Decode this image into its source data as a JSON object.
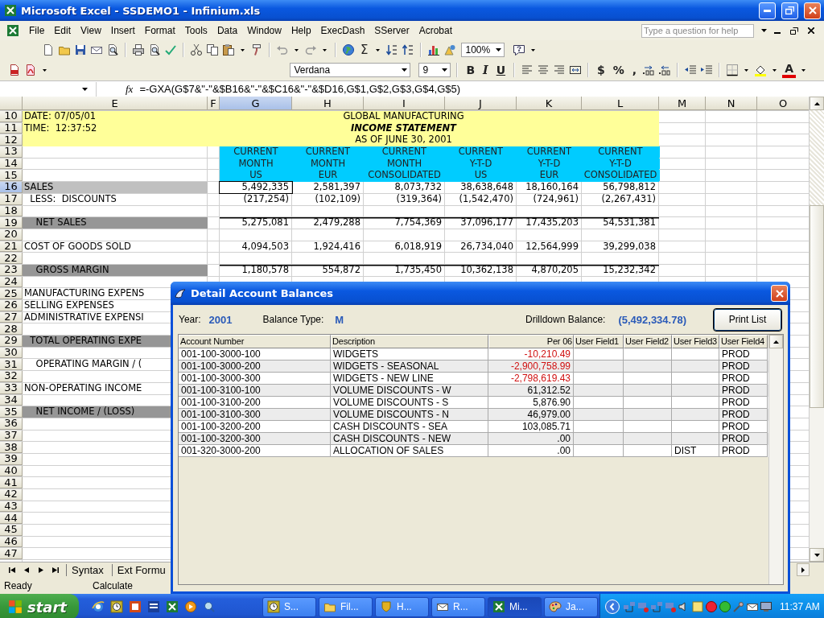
{
  "window": {
    "title": "Microsoft Excel - SSDEMO1 - Infinium.xls"
  },
  "menu": [
    "File",
    "Edit",
    "View",
    "Insert",
    "Format",
    "Tools",
    "Data",
    "Window",
    "Help",
    "ExecDash",
    "SServer",
    "Acrobat"
  ],
  "help_box": {
    "placeholder": "Type a question for help"
  },
  "toolbar": {
    "sum": "Σ",
    "zoom": "100%"
  },
  "format_toolbar": {
    "font": "Verdana",
    "size": "9",
    "bold": "B",
    "italic": "I",
    "underline": "U",
    "currency": "$",
    "percent": "%",
    "comma": ",",
    "font_color": "A"
  },
  "formula_bar": {
    "function_label": "fx",
    "formula": "=-GXA(G$7&\"-\"&$B16&\"-\"&$C16&\"-\"&$D16,G$1,G$2,G$3,G$4,G$5)"
  },
  "columns": [
    {
      "label": "E",
      "selected": false
    },
    {
      "label": "F",
      "selected": false
    },
    {
      "label": "G",
      "selected": true
    },
    {
      "label": "H",
      "selected": false
    },
    {
      "label": "I",
      "selected": false
    },
    {
      "label": "J",
      "selected": false
    },
    {
      "label": "K",
      "selected": false
    },
    {
      "label": "L",
      "selected": false
    },
    {
      "label": "M",
      "selected": false
    },
    {
      "label": "N",
      "selected": false
    },
    {
      "label": "O",
      "selected": false
    }
  ],
  "rows": [
    {
      "num": "10",
      "kind": "banner",
      "selected": false,
      "label": "DATE: 07/05/01",
      "title": "GLOBAL MANUFACTURING",
      "emphasis": false
    },
    {
      "num": "11",
      "kind": "banner",
      "selected": false,
      "label": "TIME:  12:37:52",
      "title": "INCOME STATEMENT",
      "emphasis": true
    },
    {
      "num": "12",
      "kind": "banner",
      "selected": false,
      "title": "AS OF JUNE 30, 2001",
      "emphasis": false
    },
    {
      "num": "13",
      "kind": "header",
      "selected": false,
      "values": [
        "CURRENT",
        "CURRENT",
        "CURRENT",
        "CURRENT",
        "CURRENT",
        "CURRENT"
      ]
    },
    {
      "num": "14",
      "kind": "header",
      "selected": false,
      "values": [
        "MONTH",
        "MONTH",
        "MONTH",
        "Y-T-D",
        "Y-T-D",
        "Y-T-D"
      ]
    },
    {
      "num": "15",
      "kind": "header",
      "selected": false,
      "values": [
        "US",
        "EUR",
        "CONSOLIDATED",
        "US",
        "EUR",
        "CONSOLIDATED"
      ]
    },
    {
      "num": "16",
      "kind": "data",
      "selected": true,
      "label": "SALES",
      "color": "#c0c0c0",
      "values": [
        "5,492,335",
        "2,581,397",
        "8,073,732",
        "38,638,648",
        "18,160,164",
        "56,798,812"
      ]
    },
    {
      "num": "17",
      "kind": "data",
      "selected": false,
      "label": "  LESS:  DISCOUNTS",
      "values": [
        "(217,254)",
        "(102,109)",
        "(319,364)",
        "(1,542,470)",
        "(724,961)",
        "(2,267,431)"
      ]
    },
    {
      "num": "18",
      "kind": "blank",
      "selected": false
    },
    {
      "num": "19",
      "kind": "data",
      "selected": false,
      "label": "    NET SALES",
      "color": "#969696",
      "rule_above": true,
      "values": [
        "5,275,081",
        "2,479,288",
        "7,754,369",
        "37,096,177",
        "17,435,203",
        "54,531,381"
      ]
    },
    {
      "num": "20",
      "kind": "blank",
      "selected": false
    },
    {
      "num": "21",
      "kind": "data",
      "selected": false,
      "label": "COST OF GOODS SOLD",
      "values": [
        "4,094,503",
        "1,924,416",
        "6,018,919",
        "26,734,040",
        "12,564,999",
        "39,299,038"
      ]
    },
    {
      "num": "22",
      "kind": "blank",
      "selected": false
    },
    {
      "num": "23",
      "kind": "data",
      "selected": false,
      "label": "    GROSS MARGIN",
      "color": "#969696",
      "rule_above": true,
      "values": [
        "1,180,578",
        "554,872",
        "1,735,450",
        "10,362,138",
        "4,870,205",
        "15,232,342"
      ]
    },
    {
      "num": "24",
      "kind": "blank",
      "selected": false
    },
    {
      "num": "25",
      "kind": "data",
      "selected": false,
      "label": "MANUFACTURING EXPENS"
    },
    {
      "num": "26",
      "kind": "data",
      "selected": false,
      "label": "SELLING EXPENSES"
    },
    {
      "num": "27",
      "kind": "data",
      "selected": false,
      "label": "ADMINISTRATIVE EXPENSI"
    },
    {
      "num": "28",
      "kind": "blank",
      "selected": false
    },
    {
      "num": "29",
      "kind": "data",
      "selected": false,
      "label": "  TOTAL OPERATING EXPE",
      "color": "#969696"
    },
    {
      "num": "30",
      "kind": "blank",
      "selected": false
    },
    {
      "num": "31",
      "kind": "data",
      "selected": false,
      "label": "    OPERATING MARGIN / ("
    },
    {
      "num": "32",
      "kind": "blank",
      "selected": false
    },
    {
      "num": "33",
      "kind": "data",
      "selected": false,
      "label": "NON-OPERATING INCOME"
    },
    {
      "num": "34",
      "kind": "blank",
      "selected": false
    },
    {
      "num": "35",
      "kind": "data",
      "selected": false,
      "label": "    NET INCOME / (LOSS)",
      "color": "#969696"
    },
    {
      "num": "36",
      "kind": "blank",
      "selected": false
    },
    {
      "num": "37",
      "kind": "blank",
      "selected": false
    },
    {
      "num": "38",
      "kind": "blank",
      "selected": false
    },
    {
      "num": "39",
      "kind": "blank",
      "selected": false
    },
    {
      "num": "40",
      "kind": "blank",
      "selected": false
    },
    {
      "num": "41",
      "kind": "blank",
      "selected": false
    },
    {
      "num": "42",
      "kind": "blank",
      "selected": false
    },
    {
      "num": "43",
      "kind": "blank",
      "selected": false
    },
    {
      "num": "44",
      "kind": "blank",
      "selected": false
    },
    {
      "num": "45",
      "kind": "blank",
      "selected": false
    },
    {
      "num": "46",
      "kind": "blank",
      "selected": false
    },
    {
      "num": "47",
      "kind": "blank",
      "selected": false
    }
  ],
  "sheet_tabs": [
    "Syntax",
    "Ext Formu"
  ],
  "status_bar": {
    "mode": "Ready",
    "message": "Calculate"
  },
  "dialog": {
    "title": "Detail Account Balances",
    "fields": [
      {
        "label": "Year:",
        "value": "2001"
      },
      {
        "label": "Balance Type:",
        "value": "M"
      },
      {
        "label": "Drilldown Balance:",
        "value": "(5,492,334.78)"
      }
    ],
    "print_button": "Print List",
    "columns": [
      "Account Number",
      "Description",
      "Per 06",
      "User Field1",
      "User Field2",
      "User Field3",
      "User Field4"
    ],
    "rows": [
      {
        "account": "001-100-3000-100",
        "description": "WIDGETS",
        "amount": "-10,210.49",
        "negative": true,
        "user_field4": "PROD"
      },
      {
        "account": "001-100-3000-200",
        "description": "WIDGETS - SEASONAL",
        "amount": "-2,900,758.99",
        "negative": true,
        "user_field4": "PROD"
      },
      {
        "account": "001-100-3000-300",
        "description": "WIDGETS - NEW LINE",
        "amount": "-2,798,619.43",
        "negative": true,
        "user_field4": "PROD"
      },
      {
        "account": "001-100-3100-100",
        "description": "VOLUME DISCOUNTS - W",
        "amount": "61,312.52",
        "negative": false,
        "user_field4": "PROD"
      },
      {
        "account": "001-100-3100-200",
        "description": "VOLUME DISCOUNTS - S",
        "amount": "5,876.90",
        "negative": false,
        "user_field4": "PROD"
      },
      {
        "account": "001-100-3100-300",
        "description": "VOLUME DISCOUNTS - N",
        "amount": "46,979.00",
        "negative": false,
        "user_field4": "PROD"
      },
      {
        "account": "001-100-3200-200",
        "description": "CASH DISCOUNTS - SEA",
        "amount": "103,085.71",
        "negative": false,
        "user_field4": "PROD"
      },
      {
        "account": "001-100-3200-300",
        "description": "CASH DISCOUNTS - NEW",
        "amount": ".00",
        "negative": false,
        "user_field4": "PROD"
      },
      {
        "account": "001-320-3000-200",
        "description": "ALLOCATION OF SALES",
        "amount": ".00",
        "negative": false,
        "user_field3": "DIST",
        "user_field4": "PROD"
      }
    ]
  },
  "taskbar": {
    "start": "start",
    "buttons": [
      {
        "label": "S...",
        "selected": false
      },
      {
        "label": "Fil...",
        "selected": false
      },
      {
        "label": "H...",
        "selected": false
      },
      {
        "label": "R...",
        "selected": false
      },
      {
        "label": "Mi...",
        "selected": true
      },
      {
        "label": "Ja...",
        "selected": false
      }
    ],
    "clock": "11:37 AM"
  }
}
